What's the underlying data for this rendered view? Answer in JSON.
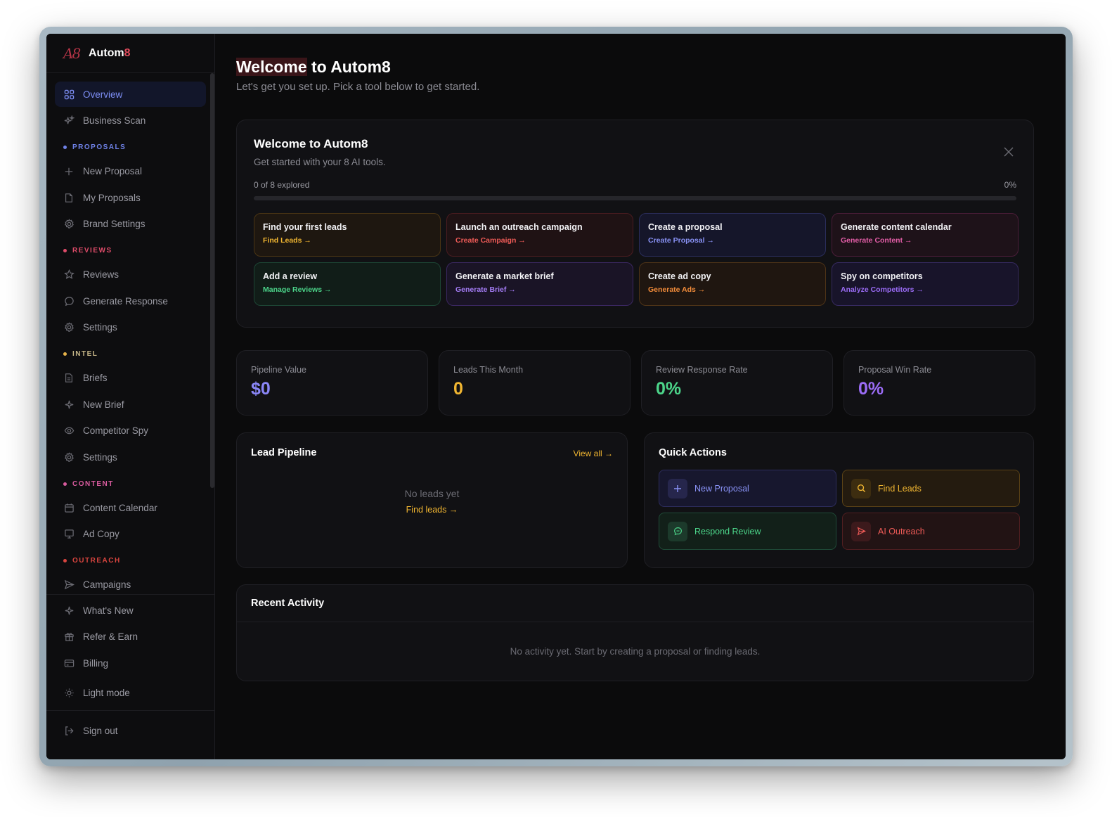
{
  "app": {
    "logo_text": "A8",
    "name_main": "Autom",
    "name_accent": "8"
  },
  "sidebar": {
    "overview": "Overview",
    "business_scan": "Business Scan",
    "sections": {
      "proposals": "PROPOSALS",
      "reviews": "REVIEWS",
      "intel": "INTEL",
      "content": "CONTENT",
      "outreach": "OUTREACH"
    },
    "proposals_items": [
      "New Proposal",
      "My Proposals",
      "Brand Settings"
    ],
    "reviews_items": [
      "Reviews",
      "Generate Response",
      "Settings"
    ],
    "intel_items": [
      "Briefs",
      "New Brief",
      "Competitor Spy",
      "Settings"
    ],
    "content_items": [
      "Content Calendar",
      "Ad Copy"
    ],
    "outreach_items": [
      "Campaigns"
    ],
    "bottom_items": [
      "What's New",
      "Refer & Earn",
      "Billing"
    ],
    "light_mode": "Light mode",
    "sign_out": "Sign out"
  },
  "header": {
    "title_highlight": "Welcome",
    "title_rest": " to Autom8",
    "subtitle": "Let's get you set up. Pick a tool below to get started."
  },
  "welcome_card": {
    "title": "Welcome to Autom8",
    "subtitle": "Get started with your 8 AI tools.",
    "progress_label": "0 of 8 explored",
    "progress_percent": "0%",
    "progress_value": 0,
    "tiles": [
      {
        "title": "Find your first leads",
        "link": "Find Leads →"
      },
      {
        "title": "Launch an outreach campaign",
        "link": "Create Campaign →"
      },
      {
        "title": "Create a proposal",
        "link": "Create Proposal →"
      },
      {
        "title": "Generate content calendar",
        "link": "Generate Content →"
      },
      {
        "title": "Add a review",
        "link": "Manage Reviews →"
      },
      {
        "title": "Generate a market brief",
        "link": "Generate Brief →"
      },
      {
        "title": "Create ad copy",
        "link": "Generate Ads →"
      },
      {
        "title": "Spy on competitors",
        "link": "Analyze Competitors →"
      }
    ]
  },
  "stats": [
    {
      "label": "Pipeline Value",
      "value": "$0"
    },
    {
      "label": "Leads This Month",
      "value": "0"
    },
    {
      "label": "Review Response Rate",
      "value": "0%"
    },
    {
      "label": "Proposal Win Rate",
      "value": "0%"
    }
  ],
  "pipeline": {
    "title": "Lead Pipeline",
    "view_all": "View all →",
    "empty": "No leads yet",
    "find_leads": "Find leads →"
  },
  "quick_actions": {
    "title": "Quick Actions",
    "items": [
      "New Proposal",
      "Find Leads",
      "Respond Review",
      "AI Outreach"
    ]
  },
  "recent": {
    "title": "Recent Activity",
    "empty": "No activity yet. Start by creating a proposal or finding leads."
  },
  "colors": {
    "accent_blue": "#7e8ff6",
    "amber": "#f1b631",
    "green": "#4cd58a",
    "purple": "#9b6cf6",
    "red": "#e14b5c"
  }
}
